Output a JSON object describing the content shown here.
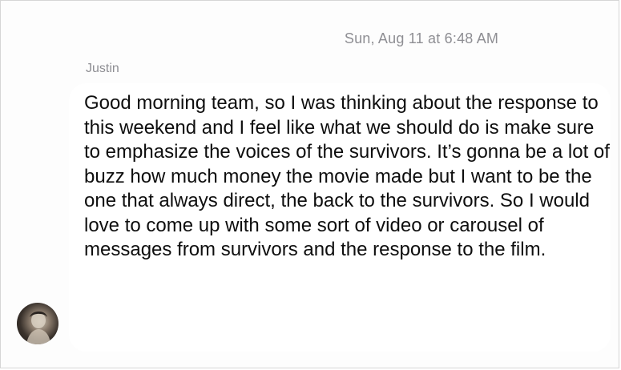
{
  "conversation": {
    "timestamp": "Sun, Aug 11 at 6:48 AM",
    "messages": [
      {
        "sender": "Justin",
        "text": "Good morning team, so I was thinking about the response to this weekend and I feel like what we should do is make sure to emphasize the voices of the survivors. It’s gonna be a lot of buzz how much money the movie made but I want to be the one that always direct, the back to the survivors. So I would love to come up with some sort of video or carousel of messages from survivors and the response to the film.",
        "avatar_icon": "person-photo-avatar"
      }
    ]
  },
  "colors": {
    "background": "#fdfdfd",
    "bubble": "#ffffff",
    "meta_text": "#8e8e93",
    "message_text": "#0e0e0e"
  }
}
